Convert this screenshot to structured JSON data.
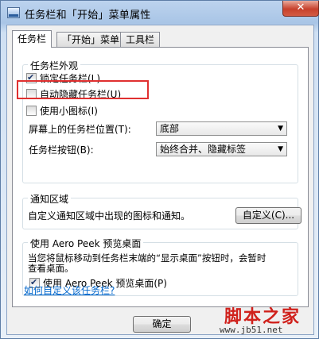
{
  "window": {
    "title": "任务栏和「开始」菜单属性",
    "close_glyph": "✕",
    "accent": "#cfe0f3"
  },
  "tabs": [
    {
      "label": "任务栏"
    },
    {
      "label": "「开始」菜单"
    },
    {
      "label": "工具栏"
    }
  ],
  "appearance": {
    "group_label": "任务栏外观",
    "lock_taskbar": {
      "label": "锁定任务栏(L)",
      "checked": true
    },
    "auto_hide": {
      "label": "自动隐藏任务栏(U)",
      "checked": false
    },
    "small_icons": {
      "label": "使用小图标(I)",
      "checked": false
    },
    "location_label": "屏幕上的任务栏位置(T):",
    "location_value": "底部",
    "buttons_label": "任务栏按钮(B):",
    "buttons_value": "始终合并、隐藏标签"
  },
  "notification": {
    "group_label": "通知区域",
    "description": "自定义通知区域中出现的图标和通知。",
    "customize_button": "自定义(C)..."
  },
  "aero_peek": {
    "group_label": "使用 Aero Peek 预览桌面",
    "description_line1": "当您将鼠标移动到任务栏末端的“显示桌面”按钮时，会暂时",
    "description_line2": "查看桌面。",
    "checkbox": {
      "label": "使用 Aero Peek 预览桌面(P)",
      "checked": true
    }
  },
  "help_link": "如何自定义该任务栏?",
  "footer": {
    "ok_button": "确定"
  },
  "watermark": {
    "brand": "脚本之家",
    "url": "www.jb51.net"
  }
}
